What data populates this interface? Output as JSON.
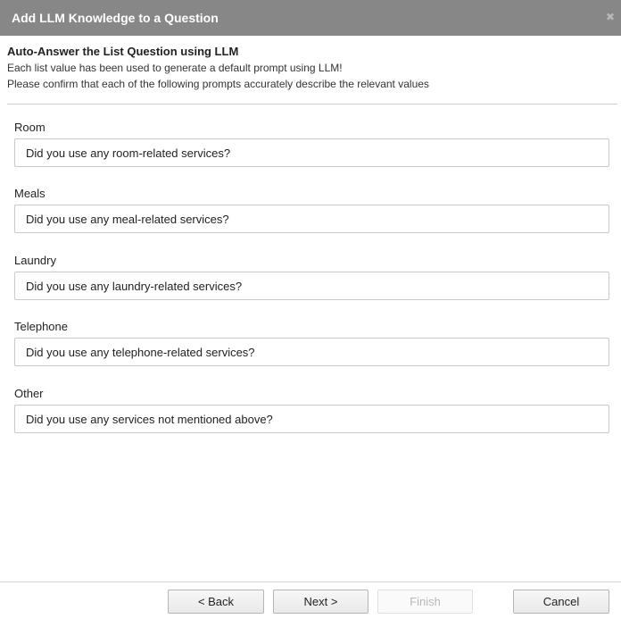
{
  "window": {
    "title": "Add LLM Knowledge to a Question",
    "close_glyph": "✖"
  },
  "intro": {
    "heading": "Auto-Answer the List Question using LLM",
    "line1": "Each list value has been used to generate a default prompt using LLM!",
    "line2": "Please confirm that each of the following prompts accurately describe the relevant values"
  },
  "prompts": [
    {
      "label": "Room",
      "value": "Did you use any room-related services?"
    },
    {
      "label": "Meals",
      "value": "Did you use any meal-related services?"
    },
    {
      "label": "Laundry",
      "value": "Did you use any laundry-related services?"
    },
    {
      "label": "Telephone",
      "value": "Did you use any telephone-related services?"
    },
    {
      "label": "Other",
      "value": "Did you use any services not mentioned above?"
    }
  ],
  "buttons": {
    "back": "< Back",
    "next": "Next >",
    "finish": "Finish",
    "cancel": "Cancel"
  },
  "colors": {
    "titlebar": "#878787",
    "border": "#c9c9c9"
  }
}
